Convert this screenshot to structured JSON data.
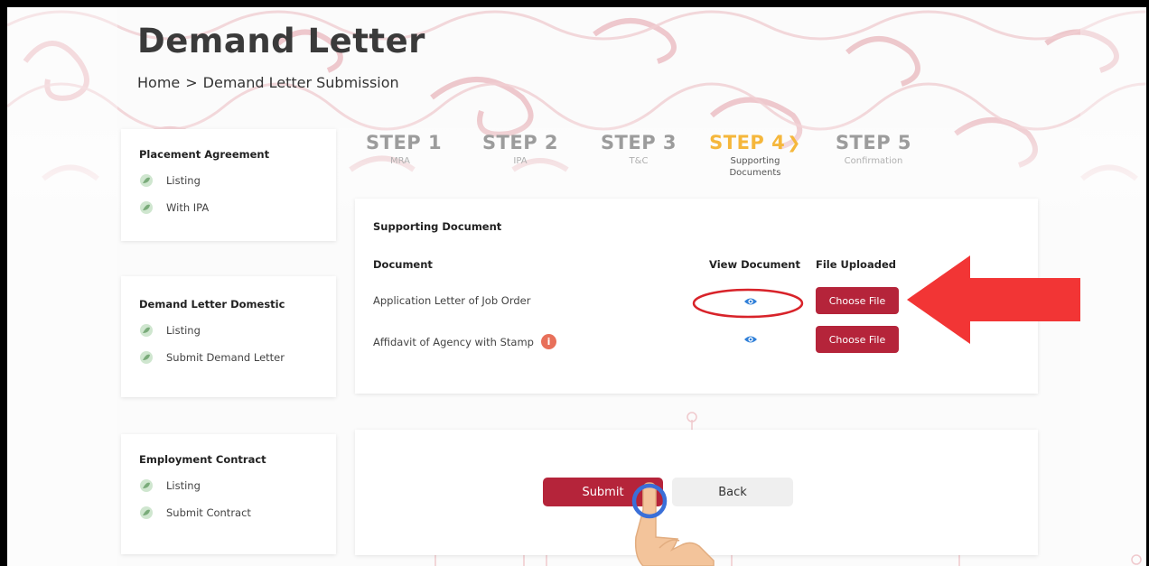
{
  "header": {
    "title": "Demand Letter",
    "breadcrumb": {
      "home": "Home",
      "separator": ">",
      "current": "Demand Letter Submission"
    }
  },
  "sidebar": {
    "placement_agreement": {
      "title": "Placement Agreement",
      "items": [
        "Listing",
        "With IPA"
      ]
    },
    "demand_letter_domestic": {
      "title": "Demand Letter Domestic",
      "items": [
        "Listing",
        "Submit Demand Letter"
      ]
    },
    "employment_contract": {
      "title": "Employment Contract",
      "items": [
        "Listing",
        "Submit Contract"
      ]
    }
  },
  "steps": [
    {
      "label": "STEP 1",
      "sub": "MRA"
    },
    {
      "label": "STEP 2",
      "sub": "IPA"
    },
    {
      "label": "STEP 3",
      "sub": "T&C"
    },
    {
      "label": "STEP 4",
      "sub": "Supporting Documents",
      "active": true
    },
    {
      "label": "STEP 5",
      "sub": "Confirmation"
    }
  ],
  "documents": {
    "section_title": "Supporting Document",
    "columns": {
      "document": "Document",
      "view": "View Document",
      "uploaded": "File Uploaded"
    },
    "rows": [
      {
        "name": "Application Letter of Job Order",
        "button": "Choose File"
      },
      {
        "name": "Affidavit of Agency with Stamp",
        "button": "Choose File",
        "info": "i"
      }
    ]
  },
  "actions": {
    "submit": "Submit",
    "back": "Back"
  },
  "colors": {
    "primary": "#b5243a",
    "active_step": "#f5b73c",
    "arrow": "#f23535",
    "highlight_circle": "#d8232a",
    "tap_ring": "#3a6fd8"
  },
  "icons": {
    "menu": "leaf-icon",
    "view": "eye-icon",
    "info": "info-icon",
    "arrow": "arrow-left-icon",
    "cursor": "hand-pointer-icon"
  }
}
